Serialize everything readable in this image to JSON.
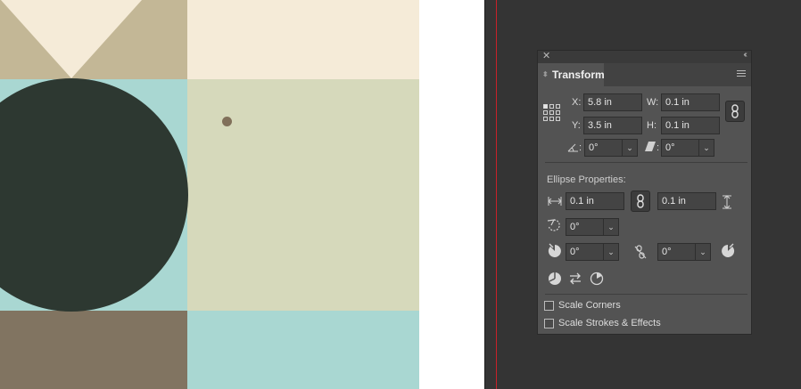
{
  "canvas": {
    "colors": {
      "cream": "#f5ebd8",
      "tan": "#c3b796",
      "aqua": "#a9d7d2",
      "sage": "#d6d9bb",
      "dark_green": "#2d3831",
      "taupe": "#817461",
      "dot": "#81705a",
      "guide": "#c8202a"
    }
  },
  "panel": {
    "tab_label": "Transform",
    "close_icon": "close-icon",
    "collapse_icon": "double-chevron-icon",
    "menu_icon": "hamburger-menu-icon",
    "transform": {
      "x_label": "X:",
      "x_value": "5.8 in",
      "y_label": "Y:",
      "y_value": "3.5 in",
      "w_label": "W:",
      "w_value": "0.1 in",
      "h_label": "H:",
      "h_value": "0.1 in",
      "rotate_label": ":",
      "rotate_value": "0°",
      "shear_label": ":",
      "shear_value": "0°"
    },
    "ellipse": {
      "section_title": "Ellipse Properties:",
      "width_value": "0.1 in",
      "height_value": "0.1 in",
      "angle_value": "0°",
      "pie_start_value": "0°",
      "pie_end_value": "0°"
    },
    "options": {
      "scale_corners": "Scale Corners",
      "scale_strokes": "Scale Strokes & Effects"
    }
  }
}
